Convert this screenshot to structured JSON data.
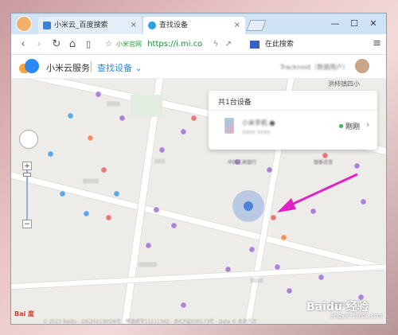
{
  "tabs": [
    {
      "label": "小米云_百度搜索"
    },
    {
      "label": "查找设备"
    }
  ],
  "window_controls": {
    "min": "—",
    "max": "☐",
    "close": "✕"
  },
  "address": {
    "site_badge": "小米官网",
    "url": "https://i.mi.co",
    "search_placeholder": "在此搜索"
  },
  "site": {
    "brand": "小米云服务",
    "section": "查找设备 ⌄",
    "user": "Tracknoid（数据用户）"
  },
  "map": {
    "street_labels": [
      "洪柿镇四小",
      "中国工商银行",
      "银泰百货"
    ],
    "zoom_plus": "+",
    "zoom_minus": "−",
    "baidu_logo": "Bai 度",
    "copyright": "© 2023 Baidu - GS(2021)6026号 - 甲测资字11111342 - 京ICP证030173号 - Data © 长地万方"
  },
  "device_panel": {
    "title": "共1台设备",
    "device_name": "小米手机 ●",
    "device_sub": "xxxx xxxx",
    "status": "刚刚",
    "status_color": "#3cb44b"
  },
  "watermark": {
    "text": "Baidu 经验",
    "sub": "jingyan.baidu.com"
  }
}
